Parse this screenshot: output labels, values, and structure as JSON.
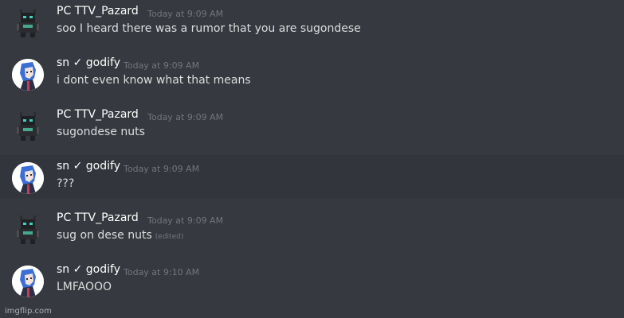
{
  "colors": {
    "background": "#36393f",
    "highlight": "#32353b",
    "username": "#ffffff",
    "message_text": "#dcddde",
    "timestamp": "#72767d"
  },
  "messages": [
    {
      "author": "PC TTV_Pazard",
      "timestamp": "Today at 9:09 AM",
      "text": "soo I heard there was a rumor that you are sugondese",
      "avatar_icon": "pixel-robot-avatar"
    },
    {
      "author": "sn ✓ godify",
      "timestamp": "Today at 9:09 AM",
      "text": "i dont even know what that means",
      "avatar_icon": "anime-character-avatar"
    },
    {
      "author": "PC TTV_Pazard",
      "timestamp": "Today at 9:09 AM",
      "text": "sugondese nuts",
      "avatar_icon": "pixel-robot-avatar"
    },
    {
      "author": "sn ✓ godify",
      "timestamp": "Today at 9:09 AM",
      "text": "???",
      "avatar_icon": "anime-character-avatar"
    },
    {
      "author": "PC TTV_Pazard",
      "timestamp": "Today at 9:09 AM",
      "text": "sug on dese nuts",
      "edited_label": "(edited)",
      "avatar_icon": "pixel-robot-avatar"
    },
    {
      "author": "sn ✓ godify",
      "timestamp": "Today at 9:10 AM",
      "text": "LMFAOOO",
      "avatar_icon": "anime-character-avatar"
    }
  ],
  "watermark": "imgflip.com"
}
